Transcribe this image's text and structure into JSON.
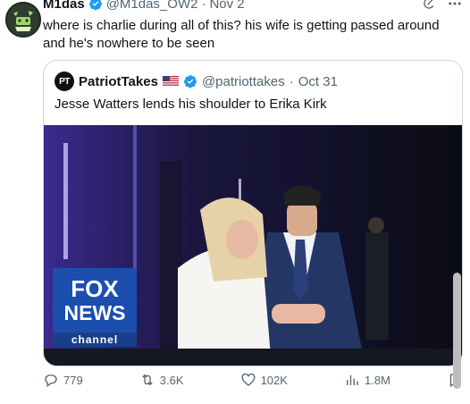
{
  "tweet": {
    "author_name": "M1das",
    "handle": "@M1das_OW2",
    "separator": "·",
    "date": "Nov 2",
    "text": "where is charlie during all of this? his wife is getting passed around and he's nowhere to be seen"
  },
  "quote": {
    "avatar_text": "PT",
    "author_name": "PatriotTakes",
    "handle": "@patriottakes",
    "separator": "·",
    "date": "Oct 31",
    "text": "Jesse Watters lends his shoulder to Erika Kirk",
    "image_logo": {
      "line1": "FOX",
      "line2": "NEWS",
      "line3": "channel"
    }
  },
  "actions": {
    "replies": "779",
    "reposts": "3.6K",
    "likes": "102K",
    "views": "1.8M"
  },
  "icons": {
    "verified": "verified-badge-icon",
    "flag": "us-flag-icon",
    "grok": "grok-icon",
    "more": "more-icon",
    "reply": "reply-icon",
    "repost": "repost-icon",
    "like": "like-icon",
    "views": "views-icon",
    "bookmark": "bookmark-icon"
  },
  "colors": {
    "verified_blue": "#1d9bf0",
    "secondary_text": "#536471",
    "primary_text": "#0f1419",
    "border": "#cfd9de"
  }
}
